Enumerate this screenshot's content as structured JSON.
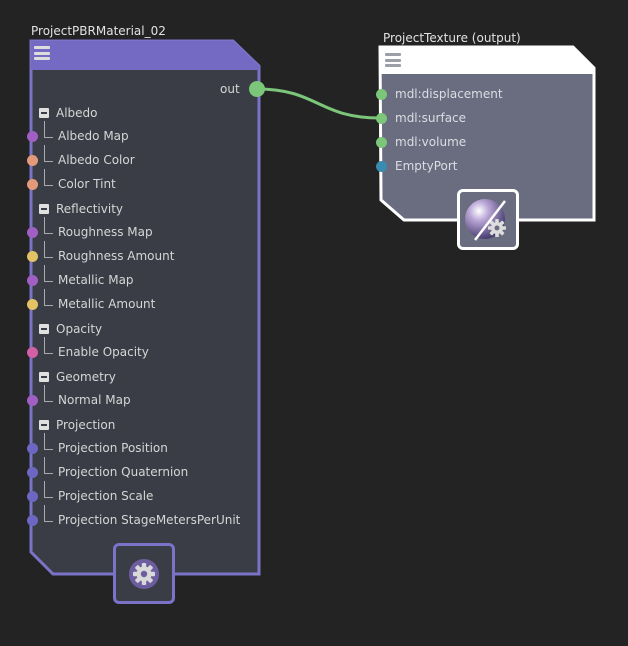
{
  "colors": {
    "background": "#232323",
    "node1_border": "#7b73c7",
    "node1_header": "#7469c3",
    "node_body": "#3a3d46",
    "node2_border": "#ffffff",
    "node2_body": "#6a6d80",
    "connection": "#7cc67a",
    "port_purple": "#a05fc4",
    "port_salmon": "#e39a7b",
    "port_yellow": "#e3c266",
    "port_pink": "#d35fa7",
    "port_blue": "#6b67c2",
    "port_green": "#7cc67a",
    "port_teal": "#3a8bb0"
  },
  "material_node": {
    "title": "ProjectPBRMaterial_02",
    "menu_icon": "hamburger-menu-icon",
    "output_label": "out",
    "groups": [
      {
        "label": "Albedo",
        "inputs": [
          {
            "label": "Albedo Map",
            "port": "port_purple"
          },
          {
            "label": "Albedo Color",
            "port": "port_salmon"
          },
          {
            "label": "Color Tint",
            "port": "port_salmon"
          }
        ]
      },
      {
        "label": "Reflectivity",
        "inputs": [
          {
            "label": "Roughness Map",
            "port": "port_purple"
          },
          {
            "label": "Roughness Amount",
            "port": "port_yellow"
          },
          {
            "label": "Metallic Map",
            "port": "port_purple"
          },
          {
            "label": "Metallic Amount",
            "port": "port_yellow"
          }
        ]
      },
      {
        "label": "Opacity",
        "inputs": [
          {
            "label": "Enable Opacity",
            "port": "port_pink"
          }
        ]
      },
      {
        "label": "Geometry",
        "inputs": [
          {
            "label": "Normal Map",
            "port": "port_purple"
          }
        ]
      },
      {
        "label": "Projection",
        "inputs": [
          {
            "label": "Projection Position",
            "port": "port_blue"
          },
          {
            "label": "Projection Quaternion",
            "port": "port_blue"
          },
          {
            "label": "Projection Scale",
            "port": "port_blue"
          },
          {
            "label": "Projection StageMetersPerUnit",
            "port": "port_blue"
          }
        ]
      }
    ],
    "footer_icon": "gear-icon"
  },
  "output_node": {
    "title": "ProjectTexture (output)",
    "menu_icon": "hamburger-menu-icon",
    "inputs": [
      {
        "label": "mdl:displacement",
        "port": "port_green"
      },
      {
        "label": "mdl:surface",
        "port": "port_green"
      },
      {
        "label": "mdl:volume",
        "port": "port_green"
      },
      {
        "label": "EmptyPort",
        "port": "port_teal"
      }
    ],
    "footer_icon": "material-settings-icon"
  }
}
